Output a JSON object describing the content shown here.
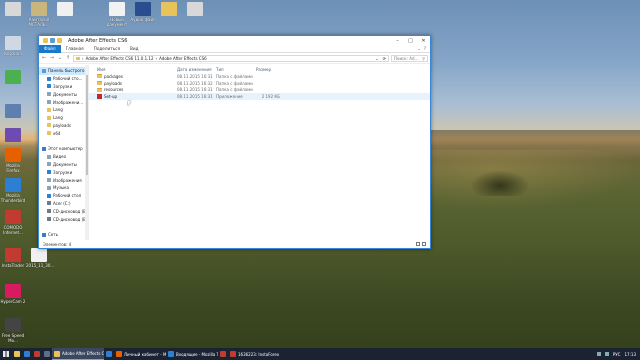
{
  "desktop": {
    "icons": [
      {
        "label": "",
        "name": "desktop-icon-1"
      },
      {
        "label": "Камтасия МСТАЛЬ...",
        "name": "desktop-icon-2"
      },
      {
        "label": "",
        "name": "desktop-icon-3"
      },
      {
        "label": "Новый документ",
        "name": "desktop-icon-4"
      },
      {
        "label": "Аудио файл",
        "name": "desktop-icon-5"
      },
      {
        "label": "",
        "name": "desktop-icon-6"
      },
      {
        "label": "",
        "name": "desktop-icon-7"
      },
      {
        "label": "Корзина",
        "name": "desktop-icon-recycle"
      },
      {
        "label": "",
        "name": "desktop-icon-4g"
      },
      {
        "label": "",
        "name": "desktop-icon-9"
      },
      {
        "label": "",
        "name": "desktop-icon-10"
      },
      {
        "label": "Mozilla Firefox",
        "name": "desktop-icon-firefox"
      },
      {
        "label": "Mozilla Thunderbird",
        "name": "desktop-icon-thunderbird"
      },
      {
        "label": "COMODO Internet...",
        "name": "desktop-icon-comodo"
      },
      {
        "label": "InstaTrader",
        "name": "desktop-icon-instatrader"
      },
      {
        "label": "2015_11_30...",
        "name": "desktop-icon-file"
      },
      {
        "label": "HyperCam 2",
        "name": "desktop-icon-hypercam"
      },
      {
        "label": "Free Speed Mo...",
        "name": "desktop-icon-speedmo"
      }
    ]
  },
  "window": {
    "title": "Adobe After Effects CS6",
    "ribbon_tabs": [
      "Файл",
      "Главная",
      "Поделиться",
      "Вид"
    ],
    "address_parts": [
      "Adobe After Effects CS6 11.0.1.12",
      "Adobe After Effects CS6"
    ],
    "search_placeholder": "Поиск: Ad...",
    "columns": {
      "name": "Имя",
      "date": "Дата изменения",
      "type": "Тип",
      "size": "Размер"
    },
    "files": [
      {
        "name": "packages",
        "date": "08.11.2015 16:31",
        "type": "Папка с файлами",
        "size": "",
        "kind": "folder"
      },
      {
        "name": "payloads",
        "date": "08.11.2015 16:32",
        "type": "Папка с файлами",
        "size": "",
        "kind": "folder"
      },
      {
        "name": "resources",
        "date": "08.11.2015 16:31",
        "type": "Папка с файлами",
        "size": "",
        "kind": "folder"
      },
      {
        "name": "Set-up",
        "date": "08.11.2015 16:31",
        "type": "Приложение",
        "size": "2 192 КБ",
        "kind": "exe"
      }
    ],
    "nav_items": [
      {
        "label": "Панель быстрого",
        "sub": false,
        "sel": true,
        "color": "#5b9bd5"
      },
      {
        "label": "Рабочий сто...",
        "sub": true,
        "sel": false,
        "color": "#2d7fd3"
      },
      {
        "label": "Загрузки",
        "sub": true,
        "sel": false,
        "color": "#2d7fd3"
      },
      {
        "label": "Документы",
        "sub": true,
        "sel": false,
        "color": "#8da2b5"
      },
      {
        "label": "Изображени...",
        "sub": true,
        "sel": false,
        "color": "#8da2b5"
      },
      {
        "label": "Lang",
        "sub": true,
        "sel": false,
        "color": "#e8c25a"
      },
      {
        "label": "Lang",
        "sub": true,
        "sel": false,
        "color": "#e8c25a"
      },
      {
        "label": "payloads",
        "sub": true,
        "sel": false,
        "color": "#e8c25a"
      },
      {
        "label": "x64",
        "sub": true,
        "sel": false,
        "color": "#e8c25a"
      },
      {
        "label": "",
        "sub": false,
        "sel": false,
        "color": "#ffffff"
      },
      {
        "label": "Этот компьютер",
        "sub": false,
        "sel": false,
        "color": "#3b7ac4"
      },
      {
        "label": "Видео",
        "sub": true,
        "sel": false,
        "color": "#8da2b5"
      },
      {
        "label": "Документы",
        "sub": true,
        "sel": false,
        "color": "#8da2b5"
      },
      {
        "label": "Загрузки",
        "sub": true,
        "sel": false,
        "color": "#2d7fd3"
      },
      {
        "label": "Изображения",
        "sub": true,
        "sel": false,
        "color": "#8da2b5"
      },
      {
        "label": "Музыка",
        "sub": true,
        "sel": false,
        "color": "#8da2b5"
      },
      {
        "label": "Рабочий стол",
        "sub": true,
        "sel": false,
        "color": "#2d7fd3"
      },
      {
        "label": "Acer (C:)",
        "sub": true,
        "sel": false,
        "color": "#6e7b86"
      },
      {
        "label": "CD-дисковод (E:)",
        "sub": true,
        "sel": false,
        "color": "#6e7b86"
      },
      {
        "label": "CD-дисковод (E:)",
        "sub": true,
        "sel": false,
        "color": "#6e7b86"
      },
      {
        "label": "",
        "sub": false,
        "sel": false,
        "color": "#ffffff"
      },
      {
        "label": "Сеть",
        "sub": false,
        "sel": false,
        "color": "#3b7ac4"
      }
    ],
    "status_text": "Элементов: 4"
  },
  "taskbar": {
    "buttons": [
      {
        "label": "",
        "name": "taskbar-pin-explorer",
        "color": "#e8c25a",
        "active": false,
        "pin": true
      },
      {
        "label": "",
        "name": "taskbar-pin-2",
        "color": "#2d7fd3",
        "active": false,
        "pin": true
      },
      {
        "label": "",
        "name": "taskbar-pin-3",
        "color": "#c23b30",
        "active": false,
        "pin": true
      },
      {
        "label": "",
        "name": "taskbar-pin-4",
        "color": "#5a6f8a",
        "active": false,
        "pin": true
      },
      {
        "label": "Adobe After Effects C...",
        "name": "taskbar-after-effects",
        "color": "#e8c25a",
        "active": true,
        "pin": false
      },
      {
        "label": "",
        "name": "taskbar-pin-6",
        "color": "#2d7fd3",
        "active": false,
        "pin": true
      },
      {
        "label": "Личный кабинет - M...",
        "name": "taskbar-firefox-cabinet",
        "color": "#e66000",
        "active": false,
        "pin": false
      },
      {
        "label": "Входящие - Mozilla T...",
        "name": "taskbar-thunderbird",
        "color": "#2d7fd3",
        "active": false,
        "pin": false
      },
      {
        "label": "",
        "name": "taskbar-pin-9",
        "color": "#c23b30",
        "active": false,
        "pin": true
      },
      {
        "label": "1636223: InstaForex H...",
        "name": "taskbar-instaforex",
        "color": "#c23b30",
        "active": false,
        "pin": false
      }
    ],
    "tray_lang": "РУС",
    "tray_time": "17:13"
  }
}
